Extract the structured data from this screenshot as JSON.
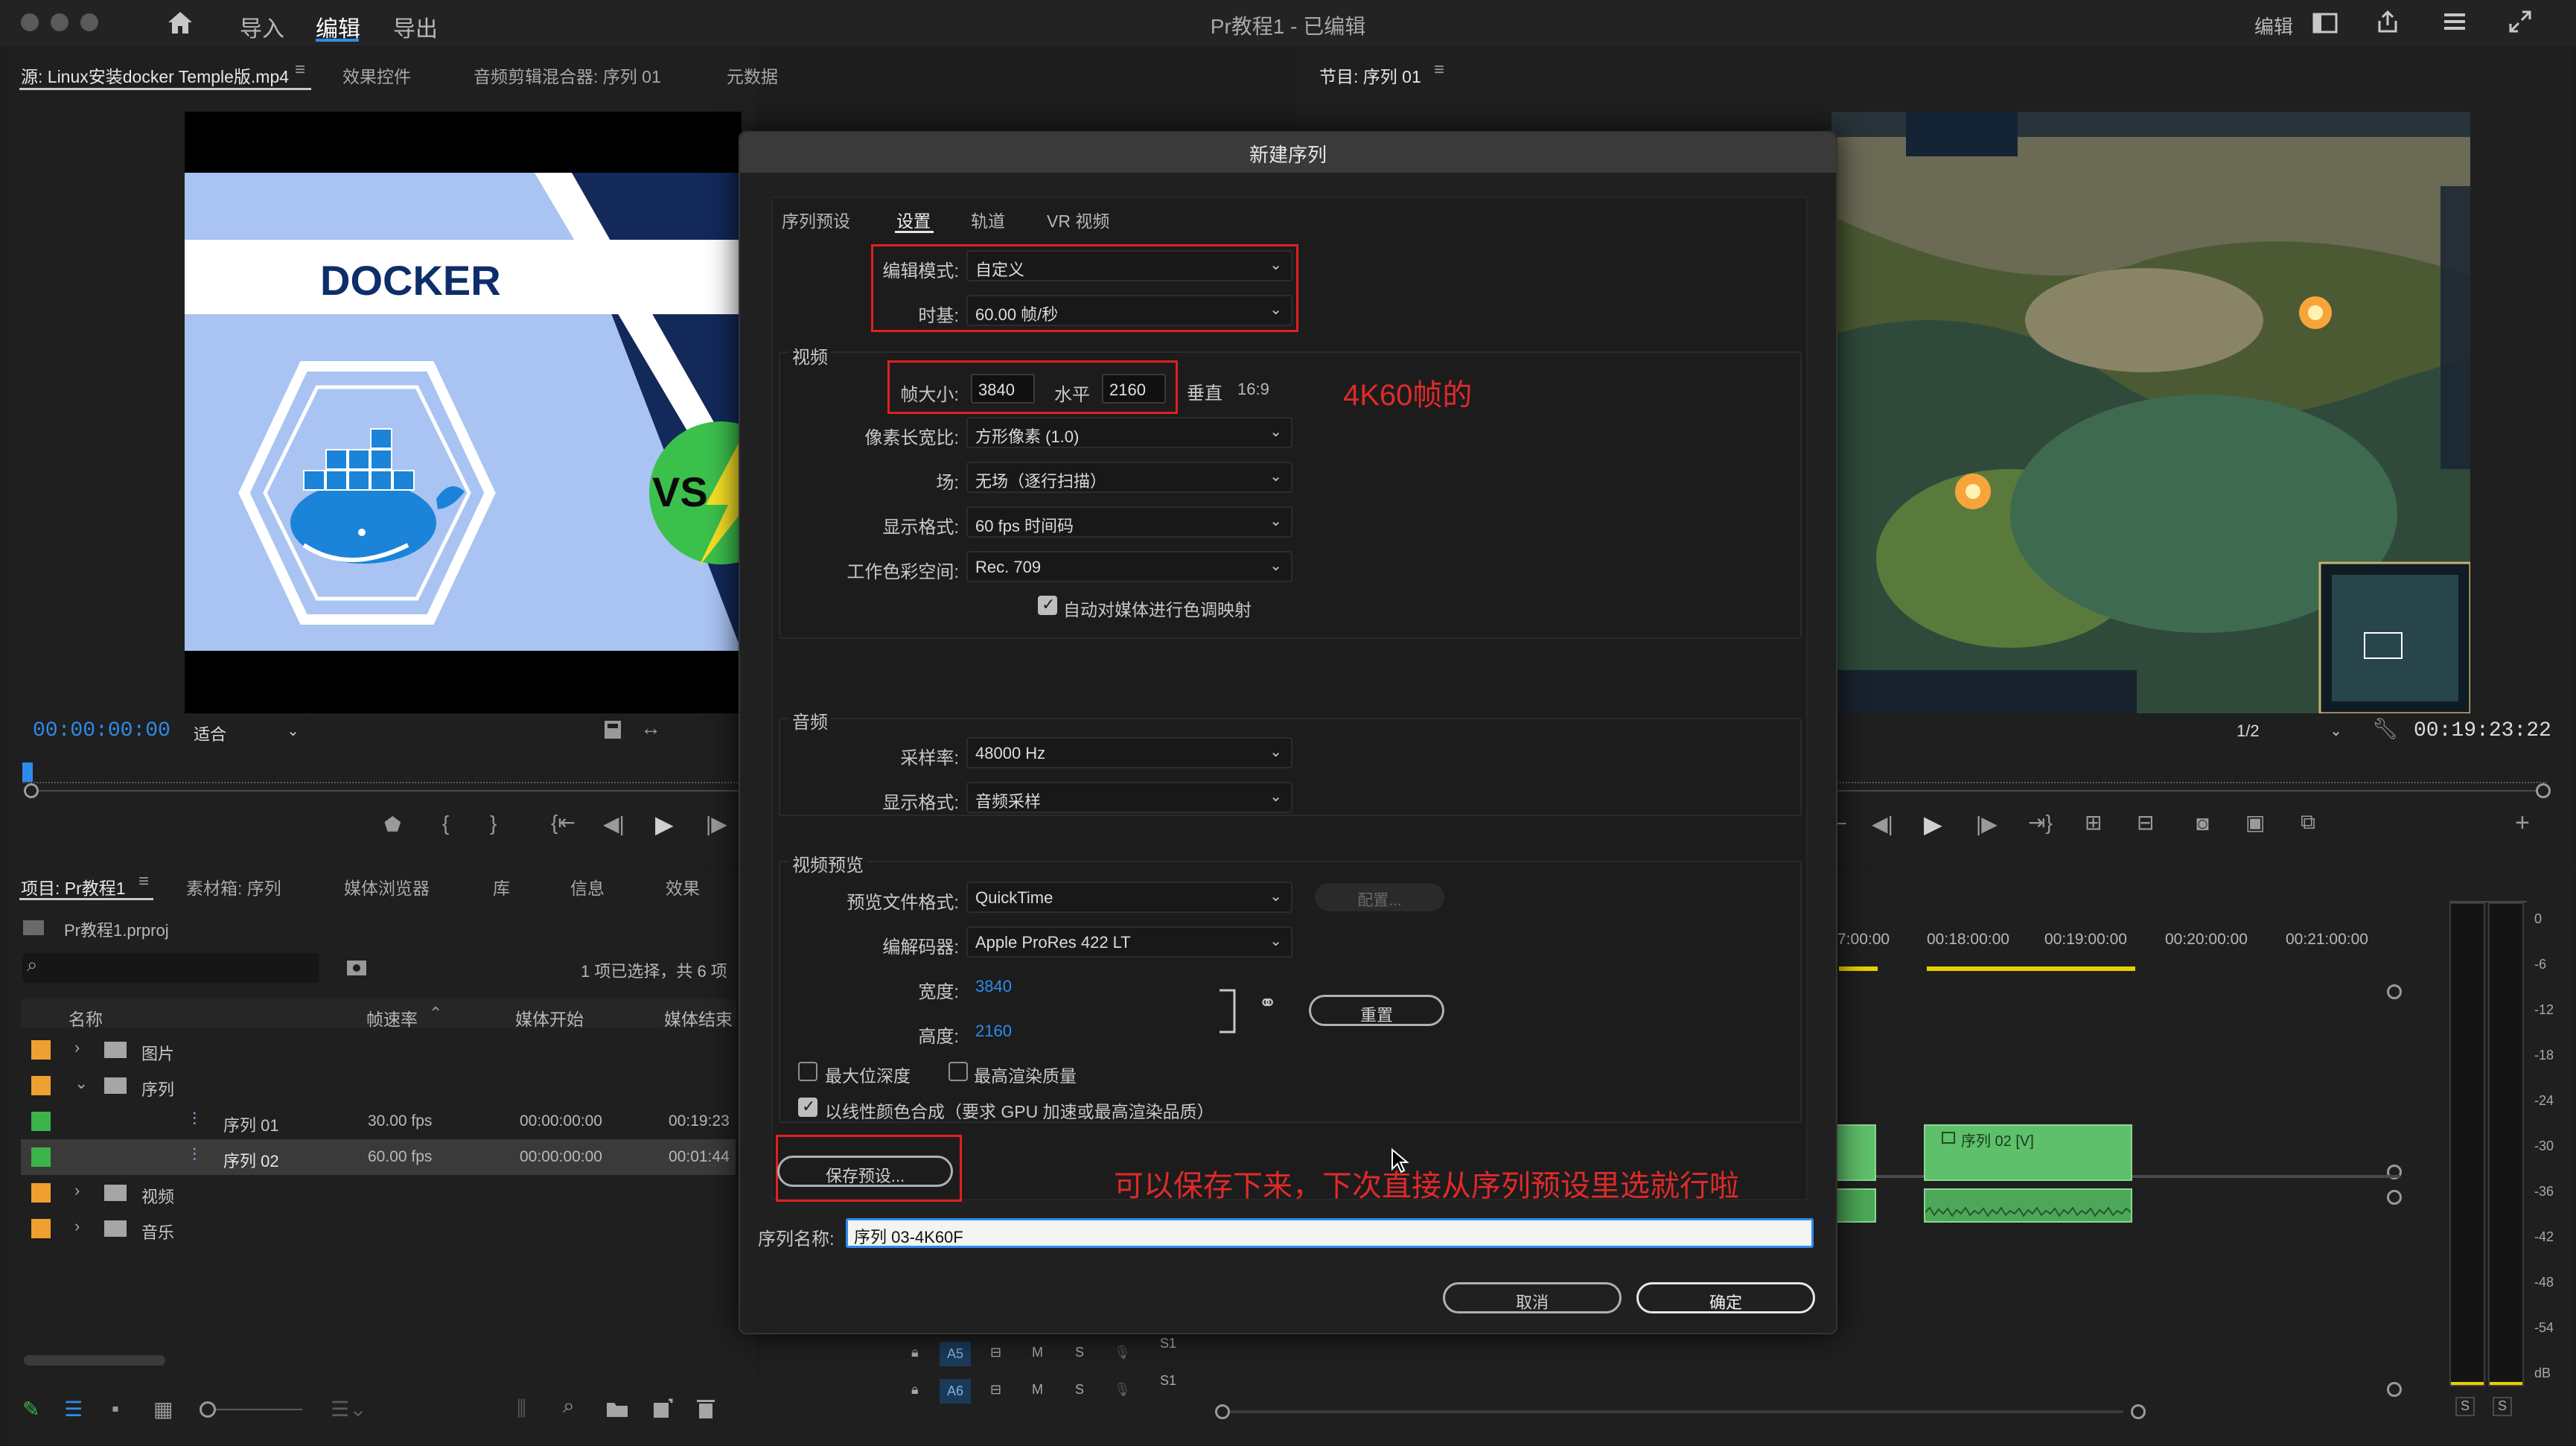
{
  "topbar": {
    "home_icon": "home-icon",
    "nav": [
      "导入",
      "编辑",
      "导出"
    ],
    "title": "Pr教程1 - 已编辑",
    "right_label": "编辑"
  },
  "source_panel": {
    "tabs": [
      "源: Linux安装docker Temple版.mp4",
      "效果控件",
      "音频剪辑混合器: 序列 01",
      "元数据"
    ],
    "thumb_text": "DOCKER",
    "vs_text": "VS",
    "timecode": "00:00:00:00",
    "fit": "适合"
  },
  "program_panel": {
    "tab": "节目: 序列 01",
    "zoom": "1/2",
    "timecode": "00:19:23:22"
  },
  "project_panel": {
    "tabs": [
      "项目: Pr教程1",
      "素材箱: 序列",
      "媒体浏览器",
      "库",
      "信息",
      "效果"
    ],
    "file": "Pr教程1.prproj",
    "selection_info": "1 项已选择，共 6 项",
    "columns": [
      "名称",
      "帧速率",
      "媒体开始",
      "媒体结束"
    ],
    "rows": [
      {
        "name": "图片",
        "fps": "",
        "start": "",
        "end": "",
        "color": "#f0a030",
        "kind": "folder",
        "indent": 0,
        "arrow": "›"
      },
      {
        "name": "序列",
        "fps": "",
        "start": "",
        "end": "",
        "color": "#f0a030",
        "kind": "folder",
        "indent": 0,
        "arrow": "⌄"
      },
      {
        "name": "序列 01",
        "fps": "30.00 fps",
        "start": "00:00:00:00",
        "end": "00:19:23",
        "color": "#3cb44a",
        "kind": "seq",
        "indent": 1,
        "arrow": ""
      },
      {
        "name": "序列 02",
        "fps": "60.00 fps",
        "start": "00:00:00:00",
        "end": "00:01:44",
        "color": "#3cb44a",
        "kind": "seq",
        "indent": 1,
        "arrow": ""
      },
      {
        "name": "视频",
        "fps": "",
        "start": "",
        "end": "",
        "color": "#f0a030",
        "kind": "folder",
        "indent": 0,
        "arrow": "›"
      },
      {
        "name": "音乐",
        "fps": "",
        "start": "",
        "end": "",
        "color": "#f0a030",
        "kind": "folder",
        "indent": 0,
        "arrow": "›"
      }
    ]
  },
  "timeline": {
    "ruler": [
      "7:00:00",
      "00:18:00:00",
      "00:19:00:00",
      "00:20:00:00",
      "00:21:00:00"
    ],
    "clip_label": "序列 02 [V]",
    "tracks": [
      {
        "name": "A5",
        "m": "M",
        "s": "S",
        "vol": "S1"
      },
      {
        "name": "A6",
        "m": "M",
        "s": "S",
        "vol": "S1"
      }
    ],
    "vu_scale": [
      "0",
      "-6",
      "-12",
      "-18",
      "-24",
      "-30",
      "-36",
      "-42",
      "-48",
      "-54",
      "dB"
    ],
    "vu_solo": [
      "S",
      "S"
    ]
  },
  "dialog": {
    "title": "新建序列",
    "tabs": [
      "序列预设",
      "设置",
      "轨道",
      "VR 视频"
    ],
    "edit_mode_label": "编辑模式:",
    "edit_mode_value": "自定义",
    "timebase_label": "时基:",
    "timebase_value": "60.00  帧/秒",
    "video_group": "视频",
    "frame_size_label": "帧大小:",
    "frame_width": "3840",
    "horizontal_label": "水平",
    "frame_height": "2160",
    "vertical_label": "垂直",
    "aspect": "16:9",
    "annotation_4k": "4K60帧的",
    "pixel_aspect_label": "像素长宽比:",
    "pixel_aspect_value": "方形像素 (1.0)",
    "fields_label": "场:",
    "fields_value": "无场（逐行扫描）",
    "display_format_label": "显示格式:",
    "display_format_value": "60 fps 时间码",
    "color_space_label": "工作色彩空间:",
    "color_space_value": "Rec. 709",
    "auto_tonemap": "自动对媒体进行色调映射",
    "audio_group": "音频",
    "sample_rate_label": "采样率:",
    "sample_rate_value": "48000 Hz",
    "audio_display_label": "显示格式:",
    "audio_display_value": "音频采样",
    "preview_group": "视频预览",
    "preview_format_label": "预览文件格式:",
    "preview_format_value": "QuickTime",
    "config_button": "配置...",
    "codec_label": "编解码器:",
    "codec_value": "Apple ProRes 422 LT",
    "width_label": "宽度:",
    "width_value": "3840",
    "height_label": "高度:",
    "height_value": "2160",
    "reset_button": "重置",
    "max_bit_depth": "最大位深度",
    "max_render_quality": "最高渲染质量",
    "linear_color": "以线性颜色合成（要求 GPU 加速或最高渲染品质）",
    "save_preset": "保存预设...",
    "annotation_save": "可以保存下来，下次直接从序列预设里选就行啦",
    "seq_name_label": "序列名称:",
    "seq_name_value": "序列 03-4K60F",
    "cancel": "取消",
    "ok": "确定",
    "accent": "#2d8ceb",
    "annotation_color": "#e02020"
  }
}
